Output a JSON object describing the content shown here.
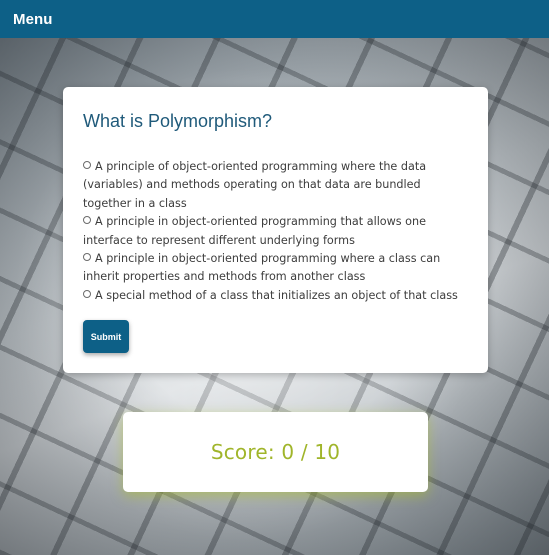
{
  "header": {
    "menu_label": "Menu"
  },
  "quiz": {
    "question": "What is Polymorphism?",
    "options": [
      "A principle of object-oriented programming where the data (variables) and methods operating on that data are bundled together in a class",
      "A principle in object-oriented programming that allows one interface to represent different underlying forms",
      "A principle in object-oriented programming where a class can inherit properties and methods from another class",
      "A special method of a class that initializes an object of that class"
    ],
    "submit_label": "Submit"
  },
  "score": {
    "text": "Score: 0 / 10"
  },
  "colors": {
    "header_bg": "#0d6087",
    "title_color": "#1f5a7a",
    "score_color": "#a0b52a"
  }
}
